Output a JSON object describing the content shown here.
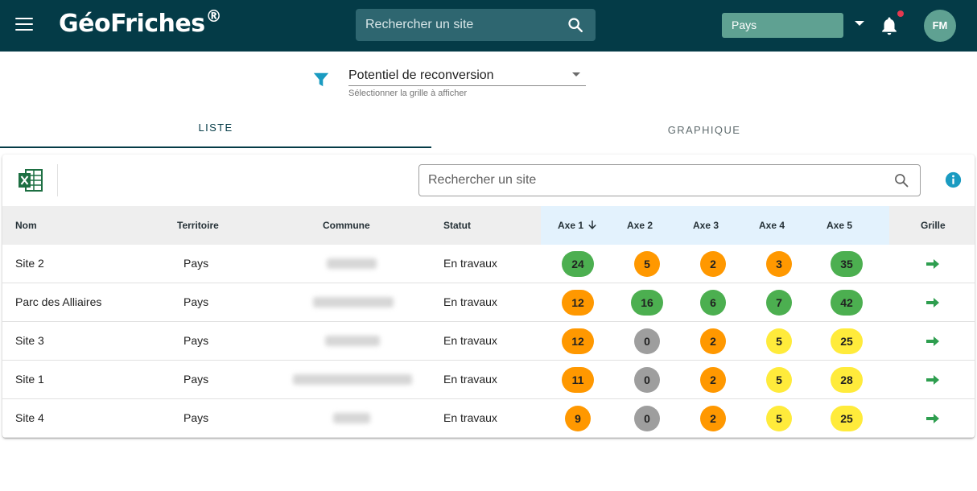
{
  "header": {
    "logo": "GéoFriches",
    "logo_mark": "®",
    "search_placeholder": "Rechercher un site",
    "country": "Pays",
    "avatar_initials": "FM",
    "menu_icon": "hamburger-menu-icon",
    "search_icon": "search-icon",
    "bell_icon": "bell-icon"
  },
  "filter": {
    "icon": "filter-icon",
    "selected": "Potentiel de reconversion",
    "hint": "Sélectionner la grille à afficher"
  },
  "tabs": [
    {
      "label": "LISTE",
      "active": true
    },
    {
      "label": "GRAPHIQUE",
      "active": false
    }
  ],
  "table": {
    "export_icon": "excel-export-icon",
    "search_placeholder": "Rechercher un site",
    "info_icon": "info-icon",
    "columns": {
      "nom": "Nom",
      "territoire": "Territoire",
      "commune": "Commune",
      "statut": "Statut",
      "axe1": "Axe 1",
      "axe2": "Axe 2",
      "axe3": "Axe 3",
      "axe4": "Axe 4",
      "axe5": "Axe 5",
      "grille": "Grille"
    },
    "sort_icon": "arrow-down-icon",
    "rows": [
      {
        "nom": "Site 2",
        "territoire": "Pays",
        "statut": "En travaux",
        "axes": [
          "24",
          "5",
          "2",
          "3",
          "35"
        ],
        "colors": [
          "green",
          "orange",
          "orange",
          "orange",
          "green"
        ]
      },
      {
        "nom": "Parc des Alliaires",
        "territoire": "Pays",
        "statut": "En travaux",
        "axes": [
          "12",
          "16",
          "6",
          "7",
          "42"
        ],
        "colors": [
          "orange",
          "green",
          "green",
          "green",
          "green"
        ]
      },
      {
        "nom": "Site 3",
        "territoire": "Pays",
        "statut": "En travaux",
        "axes": [
          "12",
          "0",
          "2",
          "5",
          "25"
        ],
        "colors": [
          "orange",
          "grey",
          "orange",
          "yellow",
          "yellow"
        ]
      },
      {
        "nom": "Site 1",
        "territoire": "Pays",
        "statut": "En travaux",
        "axes": [
          "11",
          "0",
          "2",
          "5",
          "28"
        ],
        "colors": [
          "orange",
          "grey",
          "orange",
          "yellow",
          "yellow"
        ]
      },
      {
        "nom": "Site 4",
        "territoire": "Pays",
        "statut": "En travaux",
        "axes": [
          "9",
          "0",
          "2",
          "5",
          "25"
        ],
        "colors": [
          "orange",
          "grey",
          "orange",
          "yellow",
          "yellow"
        ]
      }
    ]
  },
  "colors": {
    "green": "#4caf50",
    "orange": "#ff9800",
    "yellow": "#ffeb3b",
    "grey": "#9e9e9e",
    "header_bg": "#043b47",
    "accent": "#1a9bc1",
    "go_arrow": "#2e9e4f"
  }
}
